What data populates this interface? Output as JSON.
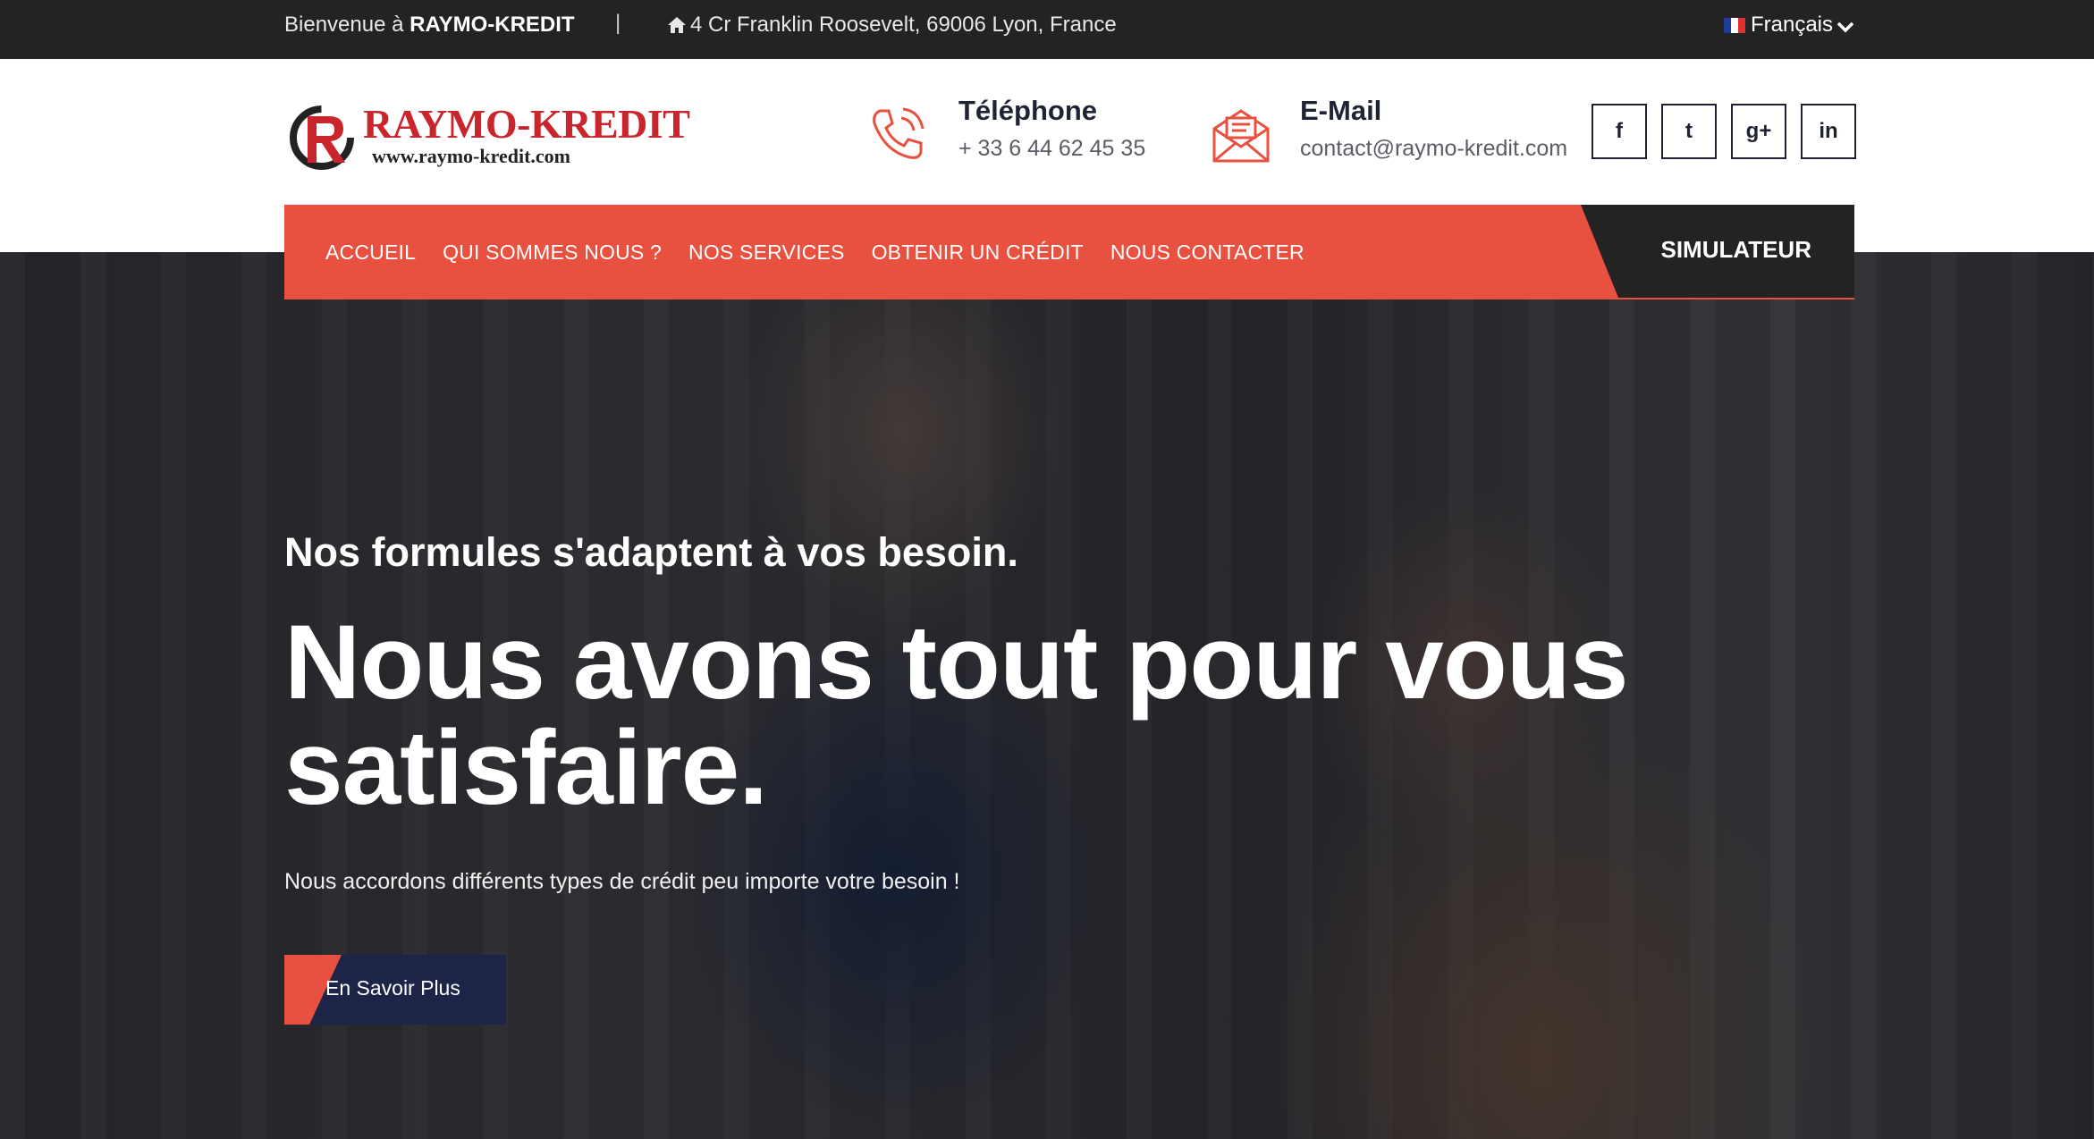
{
  "topbar": {
    "welcome_prefix": "Bienvenue à",
    "welcome_brand": "RAYMO-KREDIT",
    "separator": "|",
    "address": "4 Cr Franklin Roosevelt, 69006 Lyon, France",
    "language": "Français"
  },
  "header": {
    "logo_name": "RAYMO-KREDIT",
    "logo_url": "www.raymo-kredit.com",
    "phone_title": "Téléphone",
    "phone_value": "+ 33 6 44 62 45 35",
    "mail_title": "E-Mail",
    "mail_value": "contact@raymo-kredit.com",
    "socials": [
      "facebook-icon",
      "twitter-icon",
      "google-plus-icon",
      "linkedin-icon"
    ],
    "social_glyphs": [
      "f",
      "t",
      "g+",
      "in"
    ]
  },
  "nav": {
    "items": [
      "ACCUEIL",
      "QUI SOMMES NOUS ?",
      "NOS SERVICES",
      "OBTENIR UN CRÉDIT",
      "NOUS CONTACTER"
    ],
    "simulator": "SIMULATEUR"
  },
  "hero": {
    "subtitle": "Nos formules s'adaptent à vos besoin.",
    "title": "Nous avons tout pour vous satisfaire.",
    "description": "Nous accordons différents types de crédit peu importe votre besoin !",
    "button": "En Savoir Plus"
  },
  "colors": {
    "accent": "#e85140",
    "dark": "#232323",
    "navy": "#1c2448"
  }
}
